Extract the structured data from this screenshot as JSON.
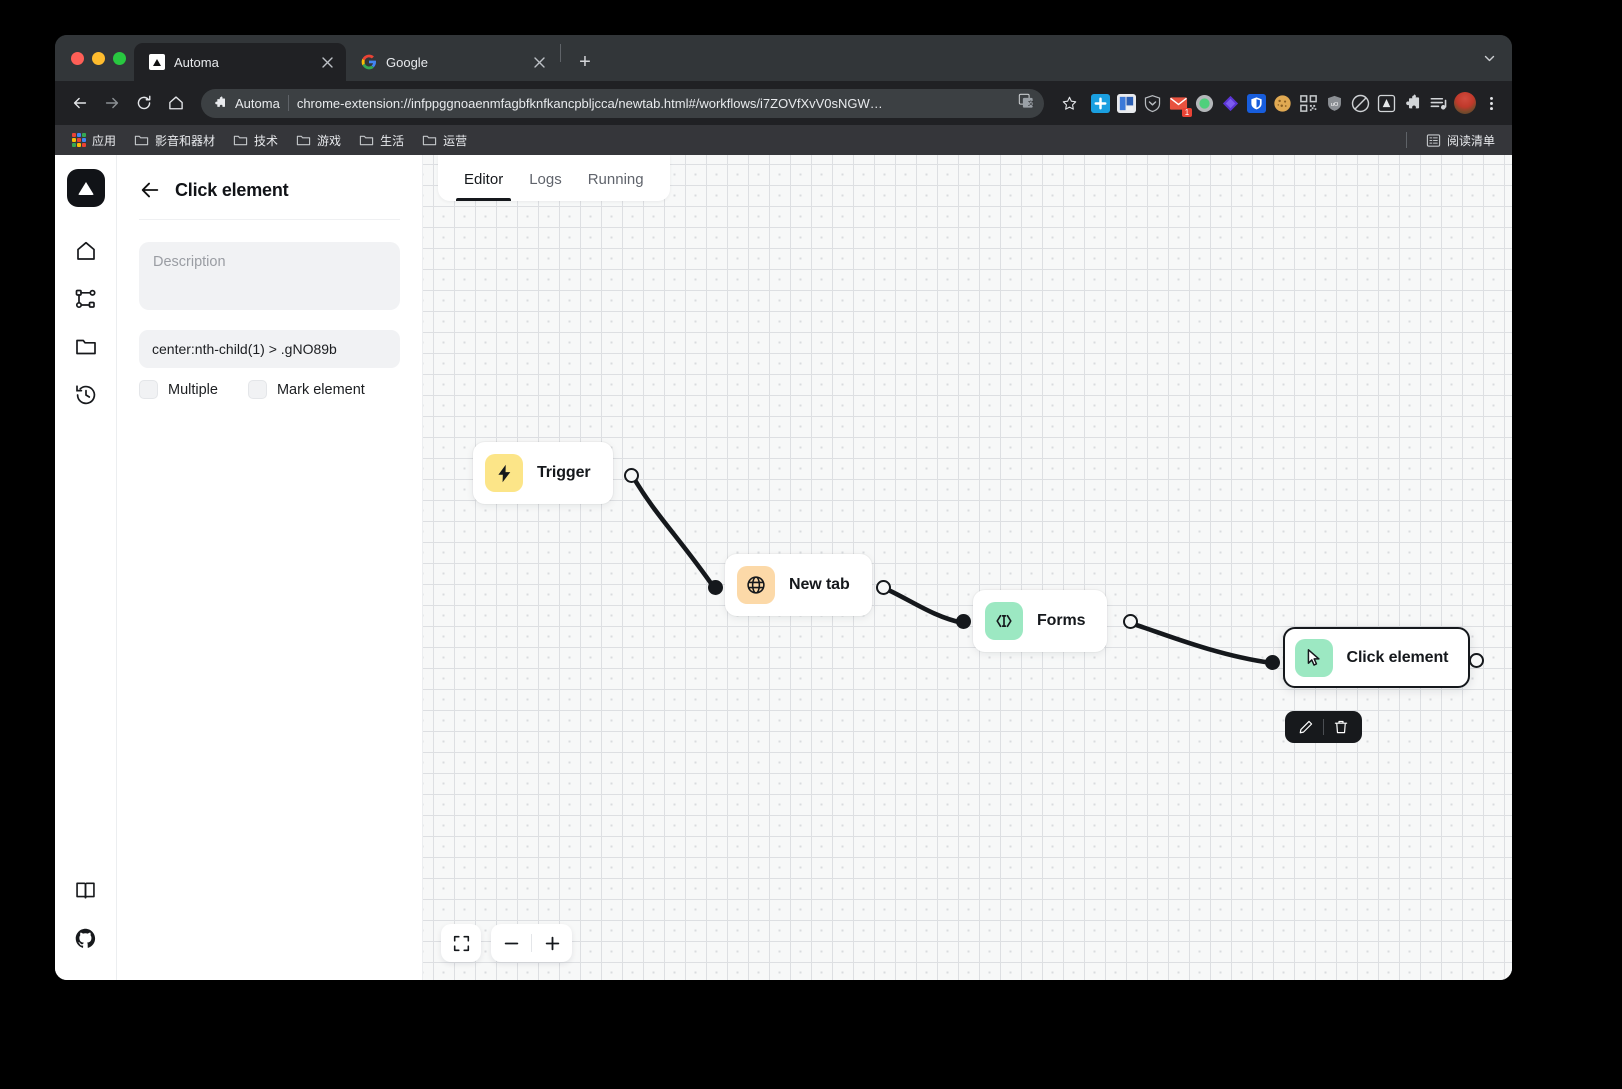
{
  "browser": {
    "tabs": [
      {
        "title": "Automa",
        "favicon": "automa-icon",
        "active": true
      },
      {
        "title": "Google",
        "favicon": "google-icon",
        "active": false
      }
    ],
    "new_tab_label": "+",
    "window_caret": "chevron-down-icon",
    "toolbar": {
      "back": "back-arrow-icon",
      "forward": "forward-arrow-icon",
      "reload": "reload-icon",
      "home": "home-icon",
      "omnibox": {
        "ext_icon": "puzzle-piece-icon",
        "ext_name": "Automa",
        "url": "chrome-extension://infppggnoaenmfagbfknfkancpbljcca/newtab.html#/workflows/i7ZOVfXvV0sNGW…",
        "translate_icon": "translate-icon",
        "bookmark_icon": "star-icon"
      },
      "extensions": [
        {
          "name": "plus-blue-icon",
          "badge": ""
        },
        {
          "name": "book-blue-icon",
          "badge": ""
        },
        {
          "name": "shield-chevron-icon",
          "badge": ""
        },
        {
          "name": "mail-red-icon",
          "badge": "1"
        },
        {
          "name": "green-circle-icon",
          "badge": ""
        },
        {
          "name": "diamond-purple-icon",
          "badge": ""
        },
        {
          "name": "bitwarden-shield-icon",
          "badge": ""
        },
        {
          "name": "cookie-icon",
          "badge": ""
        },
        {
          "name": "qr-code-icon",
          "badge": ""
        },
        {
          "name": "ublock-shield-icon",
          "badge": ""
        },
        {
          "name": "block-circle-icon",
          "badge": ""
        },
        {
          "name": "automa-ext-icon",
          "badge": ""
        },
        {
          "name": "extensions-puzzle-icon",
          "badge": ""
        },
        {
          "name": "playlist-icon",
          "badge": ""
        }
      ],
      "avatar": "profile-avatar"
    },
    "bookmarks": {
      "apps_label": "应用",
      "items": [
        {
          "label": "影音和器材"
        },
        {
          "label": "技术"
        },
        {
          "label": "游戏"
        },
        {
          "label": "生活"
        },
        {
          "label": "运营"
        }
      ],
      "reading_list_label": "阅读清单",
      "reading_list_icon": "reading-list-icon"
    }
  },
  "app": {
    "rail": {
      "logo": "automa-logo",
      "items": [
        {
          "name": "home-icon"
        },
        {
          "name": "workflows-icon"
        },
        {
          "name": "folder-icon"
        },
        {
          "name": "history-icon"
        }
      ],
      "bottom_items": [
        {
          "name": "documentation-book-icon"
        },
        {
          "name": "github-icon"
        }
      ]
    },
    "panel": {
      "back_icon": "arrow-left-icon",
      "title": "Click element",
      "description_placeholder": "Description",
      "selector_value": "center:nth-child(1) > .gNO89b",
      "checkboxes": [
        {
          "label": "Multiple",
          "checked": false
        },
        {
          "label": "Mark element",
          "checked": false
        }
      ]
    },
    "editor": {
      "tabs": [
        {
          "label": "Editor",
          "active": true
        },
        {
          "label": "Logs",
          "active": false
        },
        {
          "label": "Running",
          "active": false
        }
      ],
      "nodes": [
        {
          "id": "trigger",
          "label": "Trigger",
          "icon": "lightning-bolt-icon",
          "icon_bg": "#fce588",
          "selected": false
        },
        {
          "id": "newtab",
          "label": "New tab",
          "icon": "globe-icon",
          "icon_bg": "#fcd9a8",
          "selected": false
        },
        {
          "id": "forms",
          "label": "Forms",
          "icon": "form-input-icon",
          "icon_bg": "#9ce8c2",
          "selected": false
        },
        {
          "id": "click",
          "label": "Click element",
          "icon": "cursor-arrow-icon",
          "icon_bg": "#9ce8c2",
          "selected": true
        }
      ],
      "node_toolbar": [
        {
          "name": "edit-pencil-icon"
        },
        {
          "name": "delete-trash-icon"
        }
      ],
      "zoom_controls": [
        {
          "name": "fit-view-icon"
        },
        {
          "name": "zoom-out-icon"
        },
        {
          "name": "zoom-in-icon"
        }
      ]
    }
  },
  "colors": {
    "accent_dark": "#15181c",
    "canvas_bg": "#f7f8f8",
    "panel_field": "#f1f2f4",
    "trigger_yellow": "#fce588",
    "newtab_orange": "#fcd9a8",
    "green_mint": "#9ce8c2"
  }
}
